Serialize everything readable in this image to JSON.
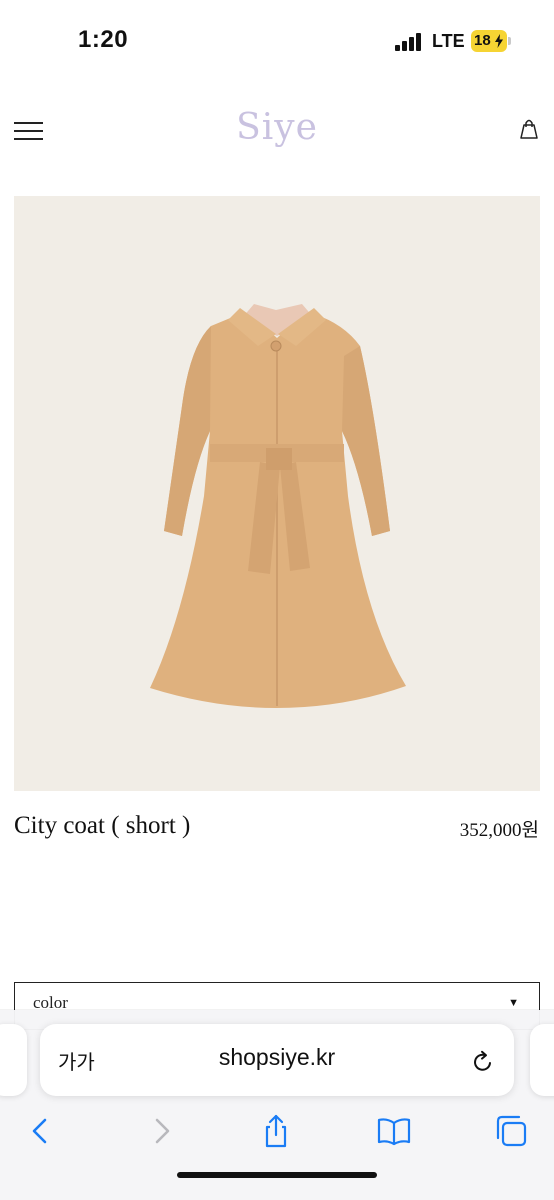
{
  "status_bar": {
    "time": "1:20",
    "network": "LTE",
    "battery": "18"
  },
  "header": {
    "logo": "Siye",
    "menu_icon": "hamburger-menu-icon",
    "cart_icon": "shopping-bag-icon"
  },
  "product": {
    "image_icon": "coat-product-image",
    "name": "City coat ( short )",
    "price": "352,000원"
  },
  "options": {
    "color_label": "color",
    "color_caret": "▼"
  },
  "browser": {
    "text_size_button": "가가",
    "url": "shopsiye.kr",
    "toolbar_icons": [
      "back-icon",
      "forward-icon",
      "share-icon",
      "bookmarks-icon",
      "tabs-icon"
    ]
  },
  "colors": {
    "accent": "#1a7cf5",
    "logo": "#c9c2e0",
    "image_bg": "#f1ede6",
    "coat": "#dfb17e"
  }
}
